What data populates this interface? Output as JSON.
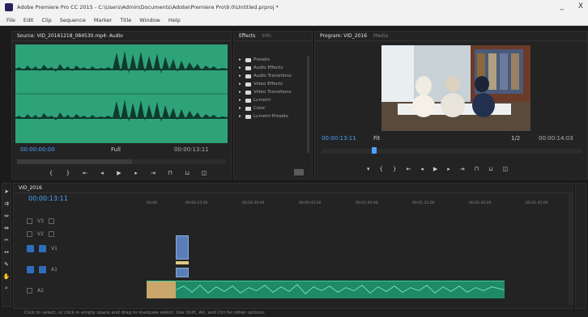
{
  "window": {
    "title": "Adobe Premiere Pro CC 2015 - C:\\Users\\Admin\\Documents\\Adobe\\Premiere Pro\\9.0\\Untitled.prproj *",
    "minimize": "_",
    "close": "X"
  },
  "menu": [
    "File",
    "Edit",
    "Clip",
    "Sequence",
    "Marker",
    "Title",
    "Window",
    "Help"
  ],
  "source": {
    "tab": "Source: VID_20161218_084530.mp4: Audio",
    "timecode_left": "00:00:00:00",
    "timecode_right": "00:00:13:11",
    "fit_label": "Full"
  },
  "effects": {
    "tab": "Effects",
    "tab2": "Info",
    "items": [
      "Presets",
      "Audio Effects",
      "Audio Transitions",
      "Video Effects",
      "Video Transitions",
      "Lumetri",
      "Color",
      "Lumetri Presets"
    ]
  },
  "program": {
    "tab": "Program: VID_2016",
    "tab2": "Media",
    "timecode_left": "00:00:13:11",
    "zoom": "Fit",
    "quality": "1/2",
    "timecode_right": "00:00:14:03"
  },
  "timeline": {
    "tab": "VID_2016",
    "timecode": "00:00:13:11",
    "ruler": [
      "00:00",
      "00:00:15:00",
      "00:00:30:00",
      "00:00:45:00",
      "00:01:00:00",
      "00:01:15:00",
      "00:01:30:00",
      "00:01:45:00",
      "00:02:00:00",
      "00:02:15:00"
    ],
    "tracks": [
      "V3",
      "V2",
      "V1",
      "A1",
      "A2"
    ]
  },
  "status": "Click to select, or click in empty space and drag to marquee select. Use Shift, Alt, and Ctrl for other options."
}
